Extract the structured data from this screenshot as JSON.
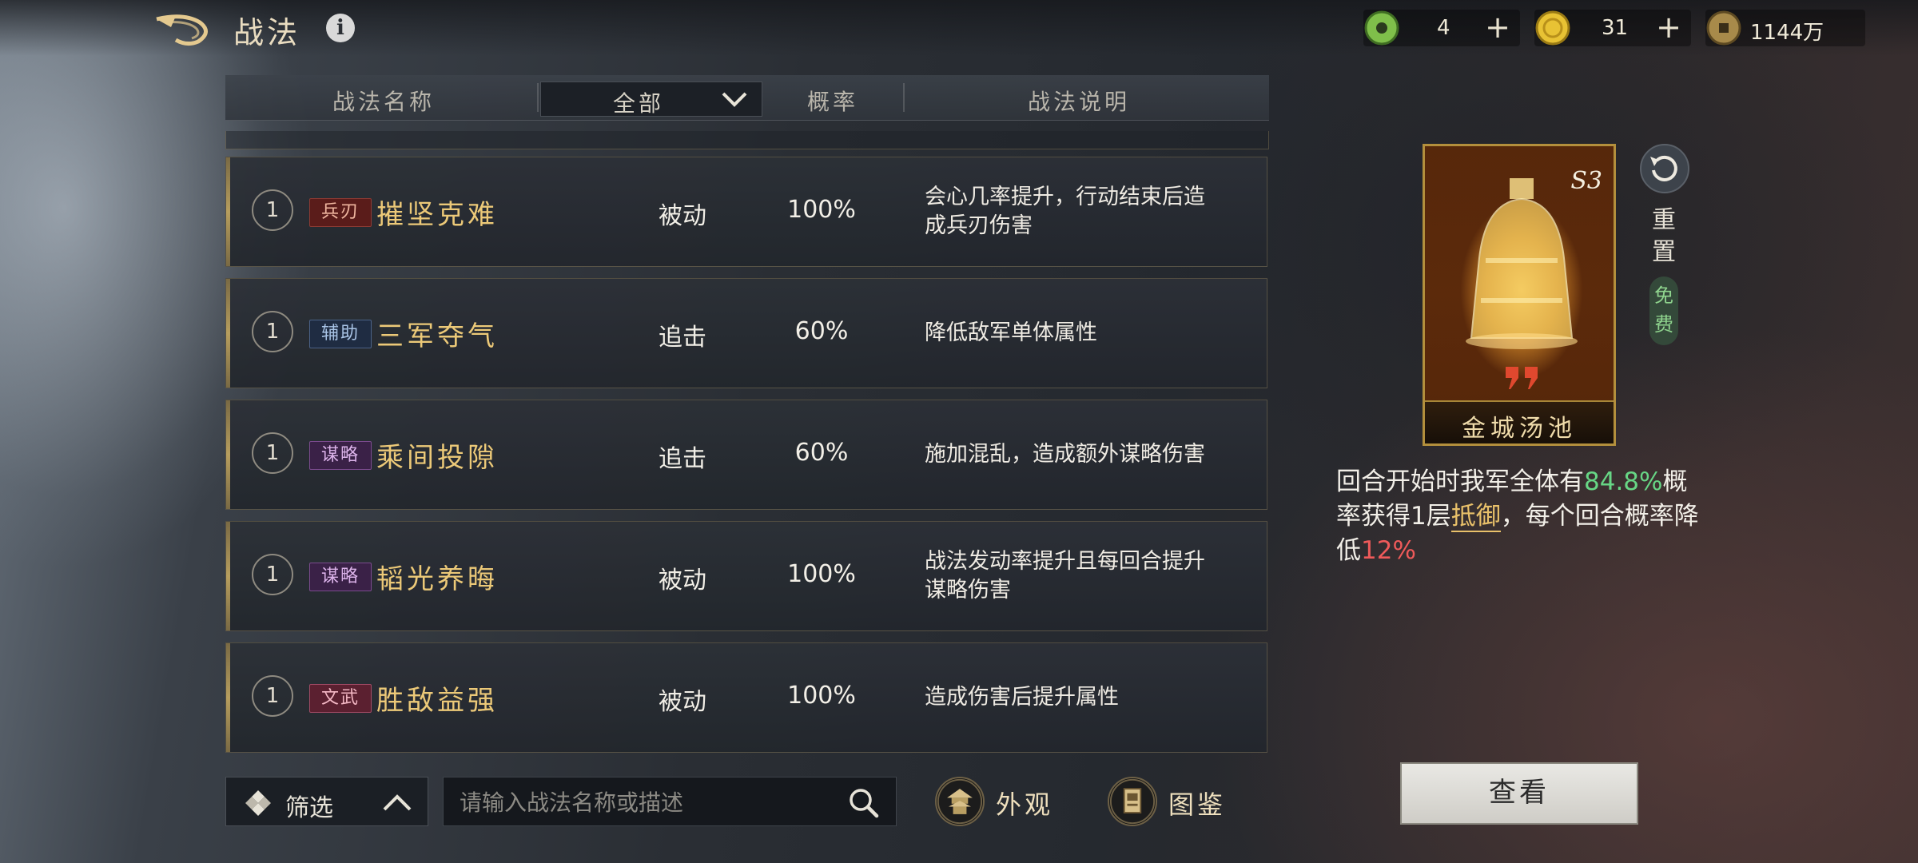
{
  "header": {
    "title": "战法",
    "info_icon": "i",
    "resources": [
      {
        "icon": "jade-coin-icon",
        "value": "4",
        "plus": "+"
      },
      {
        "icon": "gold-coin-icon",
        "value": "31",
        "plus": "+"
      },
      {
        "icon": "copper-coin-icon",
        "value": "1144万"
      }
    ]
  },
  "table": {
    "columns": [
      "战法名称",
      "概率",
      "战法说明"
    ],
    "filter_dropdown": "全部",
    "rows": [
      {
        "level": "1",
        "tag": "兵刃",
        "tag_color": "red",
        "name": "摧坚克难",
        "type": "被动",
        "rate": "100%",
        "desc_lines": [
          "会心几率提升，行动结束后造",
          "成兵刃伤害"
        ]
      },
      {
        "level": "1",
        "tag": "辅助",
        "tag_color": "blue",
        "name": "三军夺气",
        "type": "追击",
        "rate": "60%",
        "desc_lines": [
          "降低敌军单体属性"
        ]
      },
      {
        "level": "1",
        "tag": "谋略",
        "tag_color": "purple",
        "name": "乘间投隙",
        "type": "追击",
        "rate": "60%",
        "desc_lines": [
          "施加混乱，造成额外谋略伤害"
        ]
      },
      {
        "level": "1",
        "tag": "谋略",
        "tag_color": "purple",
        "name": "韬光养晦",
        "type": "被动",
        "rate": "100%",
        "desc_lines": [
          "战法发动率提升且每回合提升",
          "谋略伤害"
        ]
      },
      {
        "level": "1",
        "tag": "文武",
        "tag_color": "pink",
        "name": "胜敌益强",
        "type": "被动",
        "rate": "100%",
        "desc_lines": [
          "造成伤害后提升属性"
        ]
      }
    ]
  },
  "bottom": {
    "filter_label": "筛选",
    "search_placeholder": "请输入战法名称或描述",
    "appearance_label": "外观",
    "catalog_label": "图鉴"
  },
  "detail": {
    "card_title": "金城汤池",
    "season": "S3",
    "reset_label": "重置",
    "free_label": "免费",
    "desc": {
      "p1": "回合开始时我军全体有",
      "v1": "84.8%",
      "p2": "概率获得1层",
      "keyword": "抵御",
      "p3": "，每个回合概率降低",
      "v2": "12%"
    },
    "view_button": "查看"
  },
  "colors": {
    "skill_name_gold": "#ecc978",
    "highlight_green": "#67d685",
    "highlight_red": "#ef5a5a",
    "frame_gold": "#b38f3c"
  }
}
